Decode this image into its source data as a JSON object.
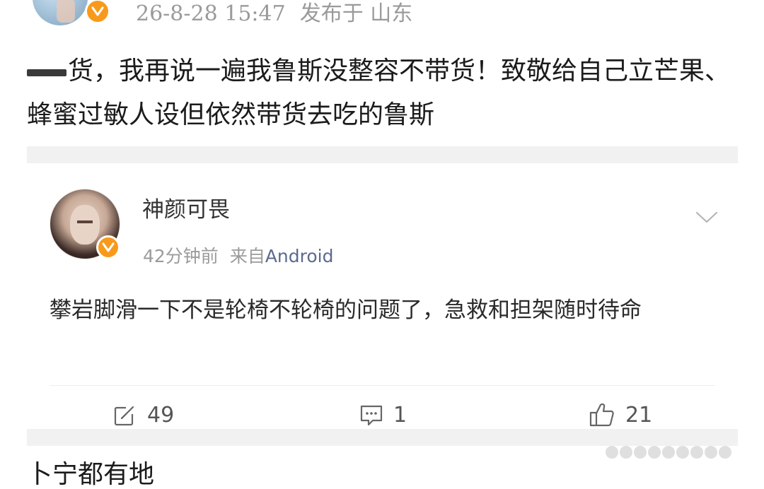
{
  "post": {
    "timestamp": "26-8-28 15:47",
    "location": "发布于 山东",
    "text": "货，我再说一遍我鲁斯没整容不带货！致敬给自己立芒果、蜂蜜过敏人设但依然带货去吃的鲁斯"
  },
  "comment": {
    "username": "神颜可畏",
    "time": "42分钟前",
    "source_prefix": "来自",
    "source": "Android",
    "text": "攀岩脚滑一下不是轮椅不轮椅的问题了，急救和担架随时待命"
  },
  "actions": {
    "repost_count": "49",
    "comment_count": "1",
    "like_count": "21"
  },
  "next_post_partial": "卜宁都有地",
  "colors": {
    "verified_badge": "#f79a1b",
    "source_link": "#5b6b8c",
    "meta_gray": "#9b9b9b"
  }
}
